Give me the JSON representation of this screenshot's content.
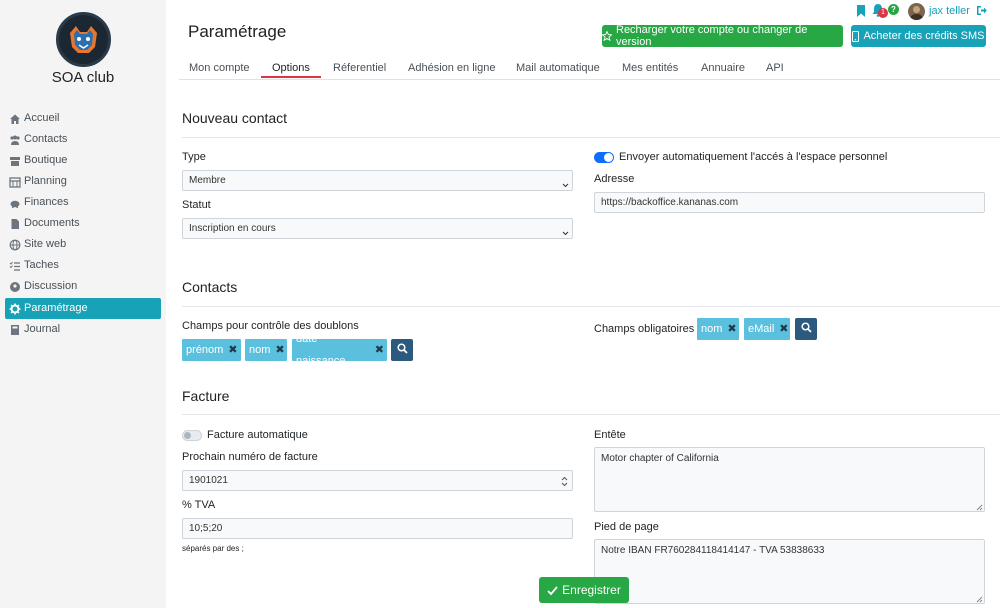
{
  "sidebar": {
    "club_name": "SOA club",
    "items": [
      {
        "label": "Accueil",
        "icon": "home-icon"
      },
      {
        "label": "Contacts",
        "icon": "users-icon"
      },
      {
        "label": "Boutique",
        "icon": "store-icon"
      },
      {
        "label": "Planning",
        "icon": "calendar-icon"
      },
      {
        "label": "Finances",
        "icon": "piggy-bank-icon"
      },
      {
        "label": "Documents",
        "icon": "file-icon"
      },
      {
        "label": "Site web",
        "icon": "globe-icon"
      },
      {
        "label": "Taches",
        "icon": "tasks-icon"
      },
      {
        "label": "Discussion",
        "icon": "comment-icon"
      },
      {
        "label": "Paramétrage",
        "icon": "gear-icon"
      },
      {
        "label": "Journal",
        "icon": "book-icon"
      }
    ]
  },
  "header": {
    "title": "Paramétrage",
    "recharge_label": "Recharger votre compte ou changer de version",
    "sms_label": "Acheter des crédits SMS",
    "user_name": "jax teller",
    "notif_count": "1",
    "help_badge": "?"
  },
  "tabs": [
    "Mon compte",
    "Options",
    "Réferentiel",
    "Adhésion en ligne",
    "Mail automatique",
    "Mes entités",
    "Annuaire",
    "API"
  ],
  "active_tab": "Options",
  "nouveau_contact": {
    "title": "Nouveau contact",
    "type_label": "Type",
    "type_value": "Membre",
    "statut_label": "Statut",
    "statut_value": "Inscription en cours",
    "toggle_label": "Envoyer automatiquement l'accés à l'espace personnel",
    "adresse_label": "Adresse",
    "adresse_value": "https://backoffice.kananas.com"
  },
  "contacts": {
    "title": "Contacts",
    "doublons_label": "Champs pour contrôle des doublons",
    "doublons_tags": [
      "prénom",
      "nom",
      "date naissance"
    ],
    "obligatoires_label": "Champs obligatoires",
    "obligatoires_tags": [
      "nom",
      "eMail"
    ]
  },
  "facture": {
    "title": "Facture",
    "auto_label": "Facture automatique",
    "numero_label": "Prochain numéro de facture",
    "numero_value": "1901021",
    "tva_label": "% TVA",
    "tva_value": "10;5;20",
    "tva_hint": "séparés par des ;",
    "entete_label": "Entête",
    "entete_value": "Motor chapter of California",
    "pied_label": "Pied de page",
    "pied_value": "Notre IBAN FR760284118414147 - TVA 53838633"
  },
  "save_label": "Enregistrer",
  "colors": {
    "accent": "#17a2b8",
    "success": "#28a745",
    "tag": "#5bc0de",
    "active_tab": "#dc3545"
  }
}
